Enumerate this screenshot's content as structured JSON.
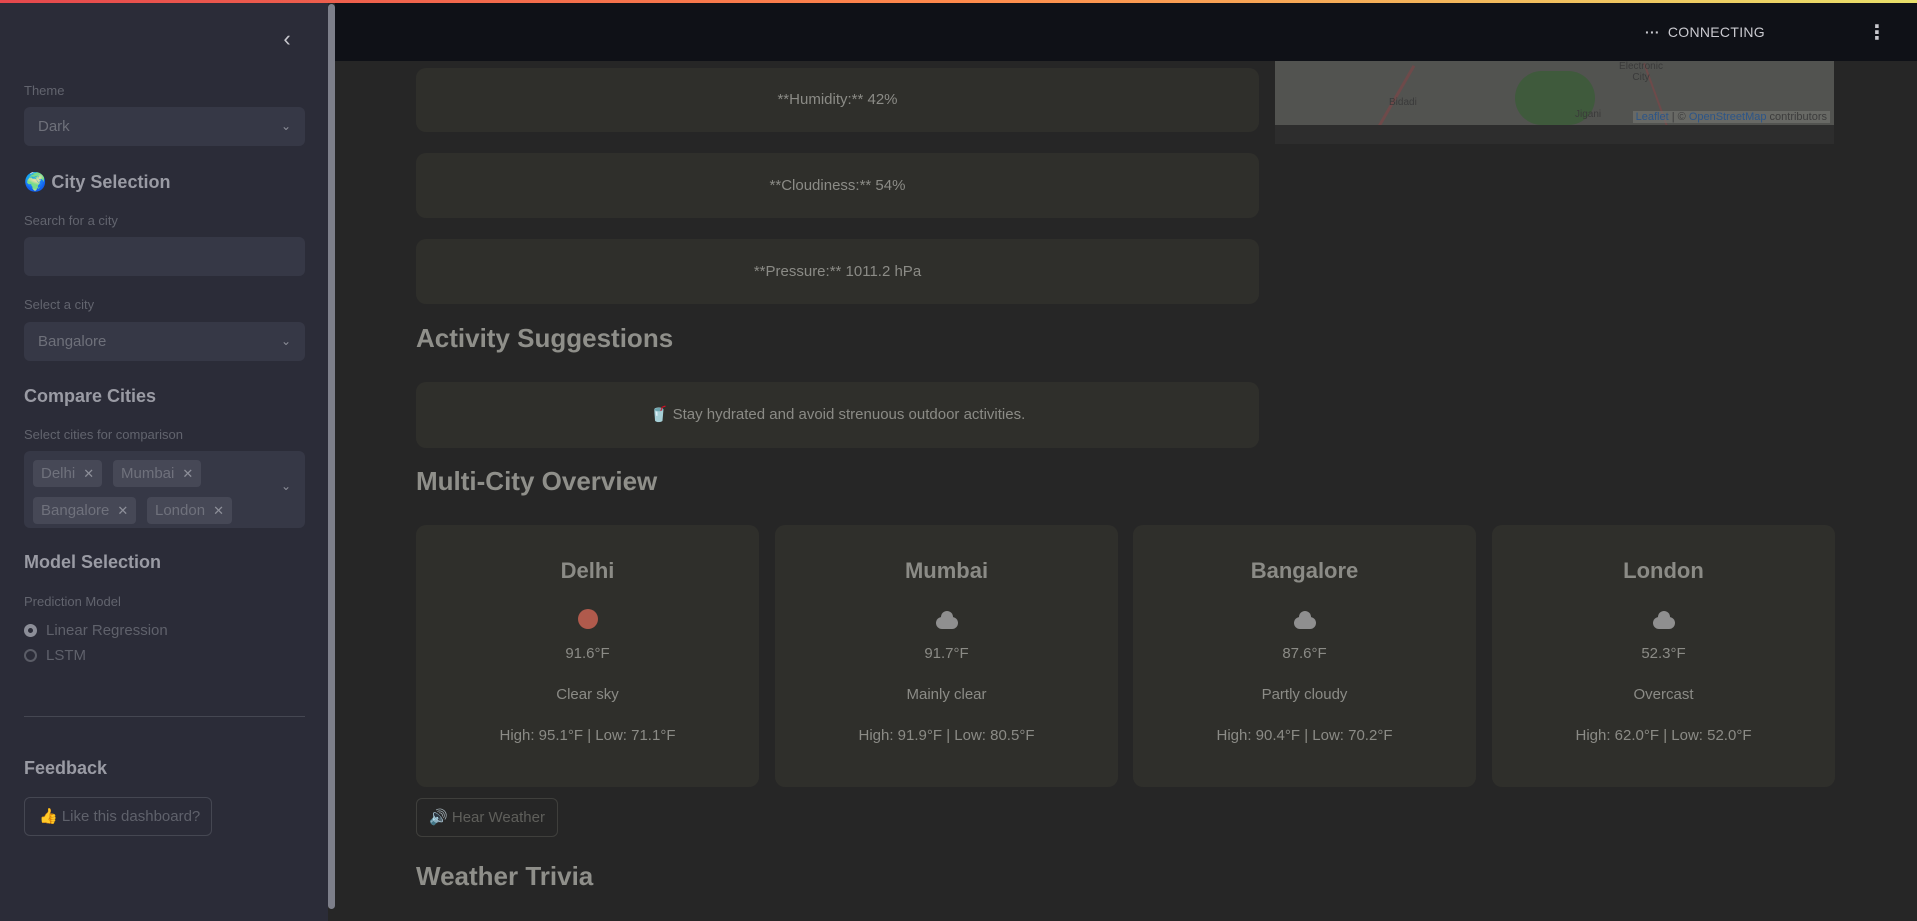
{
  "sidebar": {
    "theme_label": "Theme",
    "theme_value": "Dark",
    "city_heading": "🌍 City Selection",
    "search_label": "Search for a city",
    "search_value": "",
    "select_label": "Select a city",
    "select_value": "Bangalore",
    "compare_heading": "Compare Cities",
    "compare_label": "Select cities for comparison",
    "compare_chips": [
      "Delhi",
      "Mumbai",
      "Bangalore",
      "London"
    ],
    "model_heading": "Model Selection",
    "model_label": "Prediction Model",
    "model_options": [
      "Linear Regression",
      "LSTM"
    ],
    "model_selected": "Linear Regression",
    "feedback_heading": "Feedback",
    "feedback_button": "👍 Like this dashboard?"
  },
  "header": {
    "status": "CONNECTING"
  },
  "map": {
    "labels": [
      "Electronic City",
      "Bidadi",
      "Jigani"
    ],
    "attribution_leaflet": "Leaflet",
    "attribution_sep": " | © ",
    "attribution_osm": "OpenStreetMap",
    "attribution_tail": " contributors"
  },
  "details": {
    "humidity": "**Humidity:** 42%",
    "cloudiness": "**Cloudiness:** 54%",
    "pressure": "**Pressure:** 1011.2 hPa"
  },
  "activity": {
    "heading": "Activity Suggestions",
    "suggestion": "🥤 Stay hydrated and avoid strenuous outdoor activities."
  },
  "overview": {
    "heading": "Multi-City Overview",
    "cities": [
      {
        "name": "Delhi",
        "icon": "sun-icon",
        "temp": "91.6°F",
        "condition": "Clear sky",
        "highlow": "High: 95.1°F | Low: 71.1°F"
      },
      {
        "name": "Mumbai",
        "icon": "partly-sunny-cloud-icon",
        "temp": "91.7°F",
        "condition": "Mainly clear",
        "highlow": "High: 91.9°F | Low: 80.5°F"
      },
      {
        "name": "Bangalore",
        "icon": "cloud-icon",
        "temp": "87.6°F",
        "condition": "Partly cloudy",
        "highlow": "High: 90.4°F | Low: 70.2°F"
      },
      {
        "name": "London",
        "icon": "cloud-icon",
        "temp": "52.3°F",
        "condition": "Overcast",
        "highlow": "High: 62.0°F | Low: 52.0°F"
      }
    ],
    "hear_button": "🔊 Hear Weather"
  },
  "trivia": {
    "heading": "Weather Trivia"
  }
}
